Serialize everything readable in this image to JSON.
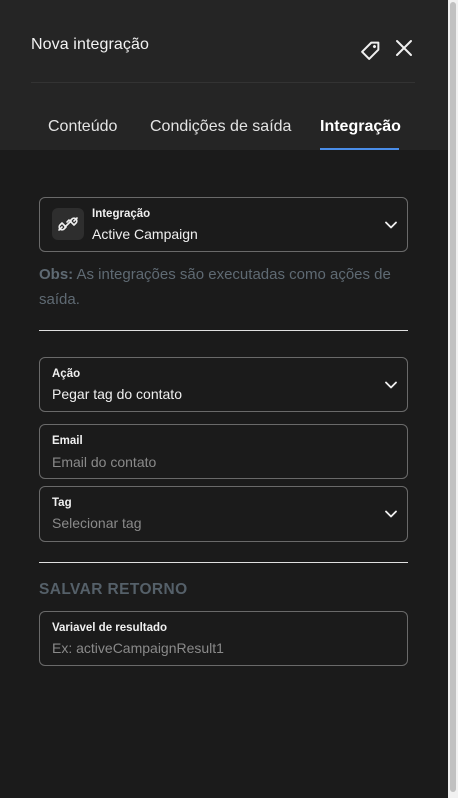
{
  "header": {
    "title": "Nova integração",
    "tag_icon": "tag-icon",
    "close_icon": "close-icon"
  },
  "tabs": [
    {
      "label": "Conteúdo",
      "active": false
    },
    {
      "label": "Condições de saída",
      "active": false
    },
    {
      "label": "Integração",
      "active": true
    }
  ],
  "integration": {
    "label": "Integração",
    "value": "Active Campaign",
    "icon": "plug-icon"
  },
  "obs": {
    "prefix": "Obs:",
    "text": " As integrações são executadas como ações de saída."
  },
  "action": {
    "label": "Ação",
    "value": "Pegar tag do contato"
  },
  "email": {
    "label": "Email",
    "placeholder": "Email do contato"
  },
  "tag": {
    "label": "Tag",
    "placeholder": "Selecionar tag"
  },
  "save_return": {
    "title": "SALVAR RETORNO",
    "result_label": "Variavel de resultado",
    "result_placeholder": "Ex: activeCampaignResult1"
  },
  "colors": {
    "accent": "#4a8de8",
    "background": "#1b1b1b",
    "header": "#252525",
    "muted": "#5f6a73"
  }
}
